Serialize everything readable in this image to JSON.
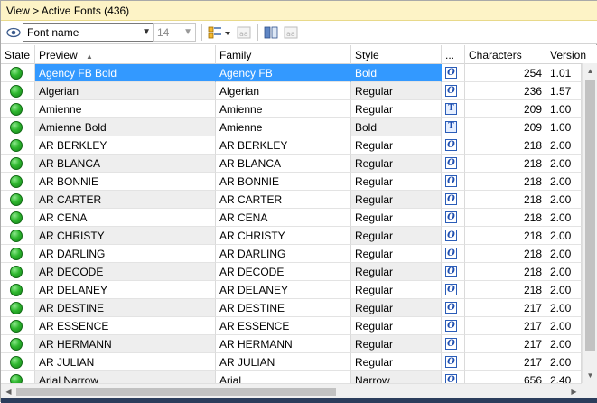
{
  "titlebar": {
    "text": "View > Active Fonts (436)"
  },
  "toolbar": {
    "font_combo_value": "Font name",
    "size_combo_value": "14",
    "icons": [
      "eye-icon",
      "grid-layout-icon",
      "dropdown-arrow-icon",
      "font-sample-icon",
      "columns-icon",
      "font-sample-icon"
    ]
  },
  "columns": {
    "state": "State",
    "preview": "Preview",
    "family": "Family",
    "style": "Style",
    "type": "...",
    "characters": "Characters",
    "version": "Version"
  },
  "rows": [
    {
      "preview": "Agency FB Bold",
      "family": "Agency FB",
      "style": "Bold",
      "type": "O",
      "characters": "254",
      "version": "1.01"
    },
    {
      "preview": "Algerian",
      "family": "Algerian",
      "style": "Regular",
      "type": "O",
      "characters": "236",
      "version": "1.57"
    },
    {
      "preview": "Amienne",
      "family": "Amienne",
      "style": "Regular",
      "type": "T",
      "characters": "209",
      "version": "1.00"
    },
    {
      "preview": "Amienne Bold",
      "family": "Amienne",
      "style": "Bold",
      "type": "T",
      "characters": "209",
      "version": "1.00"
    },
    {
      "preview": "AR BERKLEY",
      "family": "AR BERKLEY",
      "style": "Regular",
      "type": "O",
      "characters": "218",
      "version": "2.00"
    },
    {
      "preview": "AR BLANCA",
      "family": "AR BLANCA",
      "style": "Regular",
      "type": "O",
      "characters": "218",
      "version": "2.00"
    },
    {
      "preview": "AR BONNIE",
      "family": "AR BONNIE",
      "style": "Regular",
      "type": "O",
      "characters": "218",
      "version": "2.00"
    },
    {
      "preview": "AR CARTER",
      "family": "AR CARTER",
      "style": "Regular",
      "type": "O",
      "characters": "218",
      "version": "2.00"
    },
    {
      "preview": "AR CENA",
      "family": "AR CENA",
      "style": "Regular",
      "type": "O",
      "characters": "218",
      "version": "2.00"
    },
    {
      "preview": "AR CHRISTY",
      "family": "AR CHRISTY",
      "style": "Regular",
      "type": "O",
      "characters": "218",
      "version": "2.00"
    },
    {
      "preview": "AR DARLING",
      "family": "AR DARLING",
      "style": "Regular",
      "type": "O",
      "characters": "218",
      "version": "2.00"
    },
    {
      "preview": "AR DECODE",
      "family": "AR DECODE",
      "style": "Regular",
      "type": "O",
      "characters": "218",
      "version": "2.00"
    },
    {
      "preview": "AR DELANEY",
      "family": "AR DELANEY",
      "style": "Regular",
      "type": "O",
      "characters": "218",
      "version": "2.00"
    },
    {
      "preview": "AR DESTINE",
      "family": "AR DESTINE",
      "style": "Regular",
      "type": "O",
      "characters": "217",
      "version": "2.00"
    },
    {
      "preview": "AR ESSENCE",
      "family": "AR ESSENCE",
      "style": "Regular",
      "type": "O",
      "characters": "217",
      "version": "2.00"
    },
    {
      "preview": "AR HERMANN",
      "family": "AR HERMANN",
      "style": "Regular",
      "type": "O",
      "characters": "217",
      "version": "2.00"
    },
    {
      "preview": "AR JULIAN",
      "family": "AR JULIAN",
      "style": "Regular",
      "type": "O",
      "characters": "217",
      "version": "2.00"
    },
    {
      "preview": "Arial Narrow",
      "family": "Arial",
      "style": "Narrow",
      "type": "O",
      "characters": "656",
      "version": "2.40"
    }
  ],
  "colors": {
    "selection": "#3399ff",
    "titlebar": "#fdf3c6",
    "state_active": "#2fb82f"
  }
}
